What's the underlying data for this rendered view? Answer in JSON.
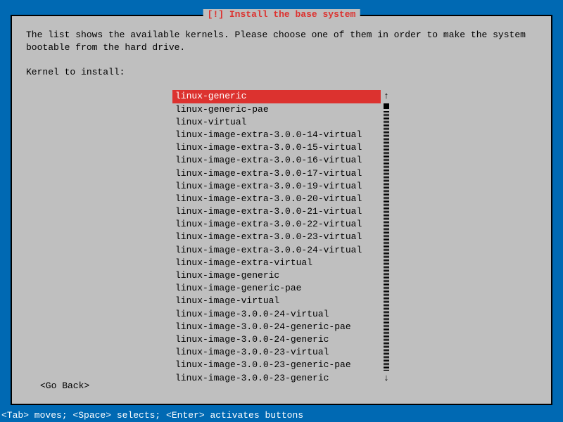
{
  "dialog": {
    "title": "[!] Install the base system",
    "instruction": "The list shows the available kernels. Please choose one of them in order to make the system bootable from the hard drive.",
    "prompt": "Kernel to install:",
    "go_back": "<Go Back>"
  },
  "kernels": [
    {
      "label": "linux-generic",
      "selected": true
    },
    {
      "label": "linux-generic-pae",
      "selected": false
    },
    {
      "label": "linux-virtual",
      "selected": false
    },
    {
      "label": "linux-image-extra-3.0.0-14-virtual",
      "selected": false
    },
    {
      "label": "linux-image-extra-3.0.0-15-virtual",
      "selected": false
    },
    {
      "label": "linux-image-extra-3.0.0-16-virtual",
      "selected": false
    },
    {
      "label": "linux-image-extra-3.0.0-17-virtual",
      "selected": false
    },
    {
      "label": "linux-image-extra-3.0.0-19-virtual",
      "selected": false
    },
    {
      "label": "linux-image-extra-3.0.0-20-virtual",
      "selected": false
    },
    {
      "label": "linux-image-extra-3.0.0-21-virtual",
      "selected": false
    },
    {
      "label": "linux-image-extra-3.0.0-22-virtual",
      "selected": false
    },
    {
      "label": "linux-image-extra-3.0.0-23-virtual",
      "selected": false
    },
    {
      "label": "linux-image-extra-3.0.0-24-virtual",
      "selected": false
    },
    {
      "label": "linux-image-extra-virtual",
      "selected": false
    },
    {
      "label": "linux-image-generic",
      "selected": false
    },
    {
      "label": "linux-image-generic-pae",
      "selected": false
    },
    {
      "label": "linux-image-virtual",
      "selected": false
    },
    {
      "label": "linux-image-3.0.0-24-virtual",
      "selected": false
    },
    {
      "label": "linux-image-3.0.0-24-generic-pae",
      "selected": false
    },
    {
      "label": "linux-image-3.0.0-24-generic",
      "selected": false
    },
    {
      "label": "linux-image-3.0.0-23-virtual",
      "selected": false
    },
    {
      "label": "linux-image-3.0.0-23-generic-pae",
      "selected": false
    },
    {
      "label": "linux-image-3.0.0-23-generic",
      "selected": false
    }
  ],
  "scroll": {
    "up": "↑",
    "down": "↓"
  },
  "hint": "<Tab> moves; <Space> selects; <Enter> activates buttons"
}
